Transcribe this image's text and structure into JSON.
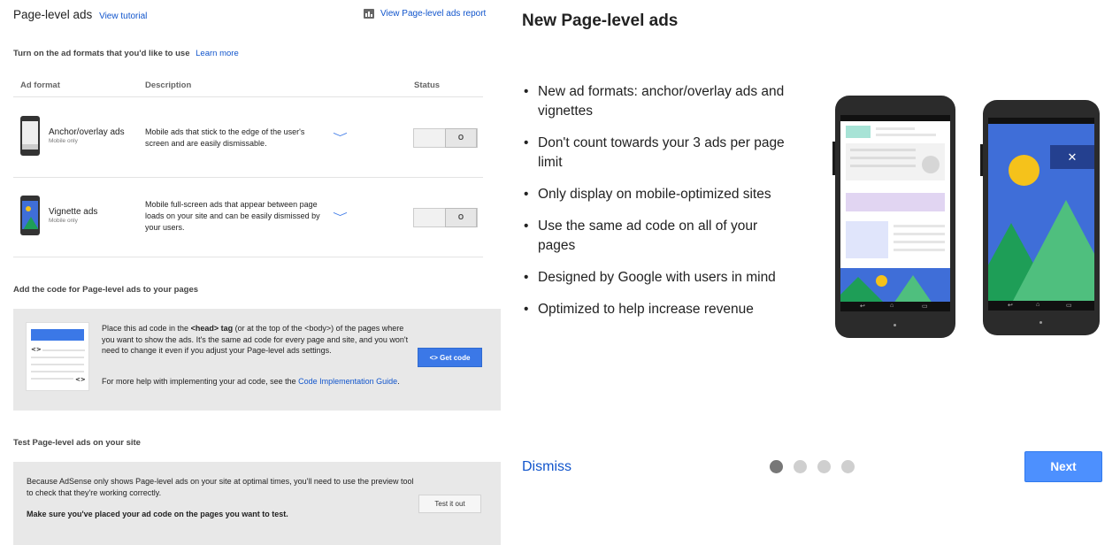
{
  "left": {
    "header_title": "Page-level ads",
    "view_tutorial": "View tutorial",
    "report_link": "View Page-level ads report",
    "turn_on_label": "Turn on the ad formats that you'd like to use",
    "learn_more": "Learn more",
    "table": {
      "col_format": "Ad format",
      "col_description": "Description",
      "col_status": "Status",
      "rows": [
        {
          "name": "Anchor/overlay ads",
          "sub": "Mobile only",
          "description": "Mobile ads that stick to the edge of the user's screen and are easily dismissable.",
          "toggle": "O"
        },
        {
          "name": "Vignette ads",
          "sub": "Mobile only",
          "description": "Mobile full-screen ads that appear between page loads on your site and can be easily dismissed by your users.",
          "toggle": "O"
        }
      ]
    },
    "add_code_title": "Add the code for Page-level ads to your pages",
    "code_box": {
      "text_1": "Place this ad code in the ",
      "text_head": "<head> tag",
      "text_2": " (or at the top of the <body>) of the pages where you want to show the ads. It's the same ad code for every page and site, and you won't need to change it even if you adjust your Page-level ads settings.",
      "help_text": "For more help with implementing your ad code, see the ",
      "help_link": "Code Implementation Guide",
      "help_end": ".",
      "get_code_label": "Get code",
      "code_symbol": "<>"
    },
    "test_title": "Test Page-level ads on your site",
    "test_box": {
      "text": "Because AdSense only shows Page-level ads on your site at optimal times, you'll need to use the preview tool to check that they're working correctly.",
      "bold_text": "Make sure you've placed your ad code on the pages you want to test.",
      "button_label": "Test it out"
    }
  },
  "dialog": {
    "title": "New Page-level ads",
    "bullets": [
      "New ad formats: anchor/overlay ads and vignettes",
      "Don't count towards your 3 ads per page limit",
      "Only display on mobile-optimized sites",
      "Use the same ad code on all of your pages",
      "Designed by Google with users in mind",
      "Optimized to help increase revenue"
    ],
    "dismiss_label": "Dismiss",
    "next_label": "Next",
    "pagination": {
      "current": 1,
      "total": 4
    },
    "close_symbol": "✕"
  },
  "colors": {
    "link": "#1155cc",
    "primary_button": "#4d90fe",
    "vignette_blue": "#3f6ed8",
    "mountain_dark": "#1e9e57",
    "mountain_light": "#4fbf7e",
    "sun": "#f5c21b"
  }
}
